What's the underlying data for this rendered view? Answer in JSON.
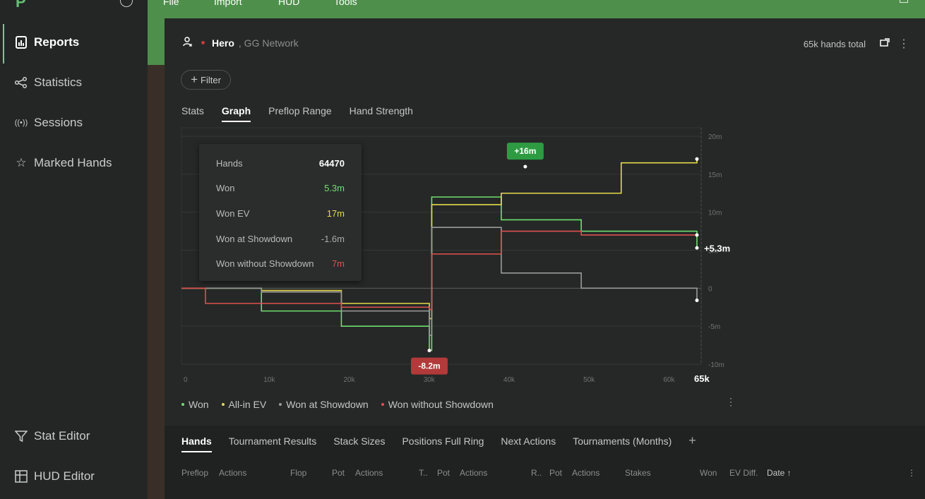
{
  "logo": "P",
  "topbar": {
    "menu": [
      "File",
      "Import",
      "HUD",
      "Tools"
    ]
  },
  "sidebar": {
    "items": [
      {
        "label": "Reports",
        "icon": "report-icon"
      },
      {
        "label": "Statistics",
        "icon": "statistics-icon"
      },
      {
        "label": "Sessions",
        "icon": "sessions-icon"
      },
      {
        "label": "Marked Hands",
        "icon": "marked-hands-icon"
      }
    ],
    "bottom": [
      {
        "label": "Stat Editor",
        "icon": "filter-funnel-icon"
      },
      {
        "label": "HUD Editor",
        "icon": "hud-editor-icon"
      }
    ]
  },
  "header": {
    "player": "Hero",
    "network": ", GG Network",
    "hands_total": "65k hands total"
  },
  "filter": {
    "label": "Filter"
  },
  "tabs": [
    "Stats",
    "Graph",
    "Preflop Range",
    "Hand Strength"
  ],
  "tooltip": [
    {
      "label": "Hands",
      "value": "64470",
      "color": "#ffffff"
    },
    {
      "label": "Won",
      "value": "5.3m",
      "color": "#6fe06f"
    },
    {
      "label": "Won EV",
      "value": "17m",
      "color": "#e6d94a"
    },
    {
      "label": "Won at Showdown",
      "value": "-1.6m",
      "color": "#a9aaaa"
    },
    {
      "label": "Won without Showdown",
      "value": "7m",
      "color": "#e05050"
    }
  ],
  "chart_data": {
    "type": "line",
    "x_ticks": [
      "0",
      "10k",
      "20k",
      "30k",
      "40k",
      "50k",
      "60k",
      "65k"
    ],
    "y_ticks": [
      "20m",
      "15m",
      "10m",
      "5m",
      "0",
      "-5m",
      "-10m"
    ],
    "ylim": [
      -10,
      20
    ],
    "xlim": [
      0,
      65000
    ],
    "series": [
      {
        "name": "Won",
        "color": "#6fe06f",
        "x": [
          0,
          10000,
          20000,
          31000,
          31300,
          40000,
          50000,
          64470
        ],
        "y": [
          0,
          -3,
          -5,
          -8.2,
          12,
          9,
          7.5,
          5.3
        ]
      },
      {
        "name": "All-in EV",
        "color": "#e6d94a",
        "x": [
          0,
          10000,
          20000,
          31000,
          31300,
          40000,
          50000,
          55000,
          64470
        ],
        "y": [
          0,
          -0.3,
          -2,
          -4,
          11,
          12.5,
          12.5,
          16.5,
          17
        ]
      },
      {
        "name": "Won at Showdown",
        "color": "#9a9a9a",
        "x": [
          0,
          10000,
          20000,
          31000,
          31300,
          40000,
          50000,
          64470
        ],
        "y": [
          0,
          -0.5,
          -3,
          -6.2,
          8,
          2,
          0,
          -1.6
        ]
      },
      {
        "name": "Won without Showdown",
        "color": "#e05050",
        "x": [
          0,
          3000,
          20000,
          31000,
          31300,
          40000,
          50000,
          64470
        ],
        "y": [
          0,
          -2,
          -2.5,
          -2.8,
          4.5,
          7.5,
          7,
          7
        ]
      }
    ],
    "annotations": [
      {
        "label": "+16m",
        "x": 43000,
        "y": 16,
        "color": "#2e9b43"
      },
      {
        "label": "-8.2m",
        "x": 31000,
        "y": -8.2,
        "color": "#b23a3a"
      },
      {
        "label": "+5.3m",
        "x": 64470,
        "y": 5.3,
        "color": "#ffffff"
      }
    ],
    "grid": true
  },
  "legend_menu": "⋮",
  "bottom_tabs": [
    "Hands",
    "Tournament Results",
    "Stack Sizes",
    "Positions Full Ring",
    "Next Actions",
    "Tournaments (Months)"
  ],
  "columns": [
    "Preflop",
    "Actions",
    "Flop",
    "Pot",
    "Actions",
    "T..",
    "Pot",
    "Actions",
    "R..",
    "Pot",
    "Actions",
    "Stakes",
    "Won",
    "EV Diff.",
    "Date ↑"
  ]
}
